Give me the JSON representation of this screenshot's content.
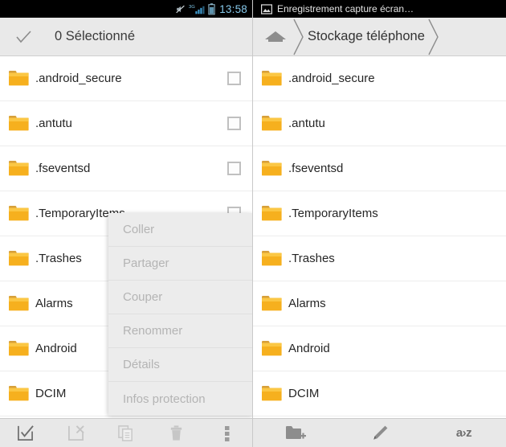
{
  "left": {
    "statusbar": {
      "time": "13:58",
      "icons": [
        "mute-crossed-icon",
        "signal-3g-icon",
        "battery-icon"
      ],
      "network_label": "3G"
    },
    "actionbar": {
      "check_icon": "checkmark-icon",
      "title": "0 Sélectionné"
    },
    "rows": [
      {
        "name": ".android_secure",
        "icon": "folder-icon",
        "checked": false
      },
      {
        "name": ".antutu",
        "icon": "folder-icon",
        "checked": false
      },
      {
        "name": ".fseventsd",
        "icon": "folder-icon",
        "checked": false
      },
      {
        "name": ".TemporaryItems",
        "icon": "folder-icon",
        "checked": false
      },
      {
        "name": ".Trashes",
        "icon": "folder-icon",
        "checked": false
      },
      {
        "name": "Alarms",
        "icon": "folder-icon",
        "checked": false
      },
      {
        "name": "Android",
        "icon": "folder-icon",
        "checked": false
      },
      {
        "name": "DCIM",
        "icon": "folder-icon",
        "checked": false
      }
    ],
    "context_menu": {
      "items": [
        {
          "label": "Coller",
          "disabled": true
        },
        {
          "label": "Partager",
          "disabled": true
        },
        {
          "label": "Couper",
          "disabled": true
        },
        {
          "label": "Renommer",
          "disabled": true
        },
        {
          "label": "Détails",
          "disabled": true
        },
        {
          "label": "Infos protection",
          "disabled": true
        }
      ]
    },
    "toolbar": {
      "buttons": [
        {
          "name": "select-all-icon",
          "label": "Tout sélectionner",
          "disabled": false
        },
        {
          "name": "deselect-all-icon",
          "label": "Tout désélectionner",
          "disabled": true
        },
        {
          "name": "copy-icon",
          "label": "Copier",
          "disabled": true
        },
        {
          "name": "delete-icon",
          "label": "Supprimer",
          "disabled": true
        },
        {
          "name": "overflow-menu-icon",
          "label": "Plus",
          "disabled": false
        }
      ]
    }
  },
  "right": {
    "statusbar": {
      "notification_icon": "screenshot-image-icon",
      "notification_text": "Enregistrement capture écran…"
    },
    "breadcrumb": {
      "home_icon": "home-icon",
      "segments": [
        "Stockage téléphone"
      ],
      "separator_icon": "chevron-right-icon"
    },
    "rows": [
      {
        "name": ".android_secure",
        "icon": "folder-icon"
      },
      {
        "name": ".antutu",
        "icon": "folder-icon"
      },
      {
        "name": ".fseventsd",
        "icon": "folder-icon"
      },
      {
        "name": ".TemporaryItems",
        "icon": "folder-icon"
      },
      {
        "name": ".Trashes",
        "icon": "folder-icon"
      },
      {
        "name": "Alarms",
        "icon": "folder-icon"
      },
      {
        "name": "Android",
        "icon": "folder-icon"
      },
      {
        "name": "DCIM",
        "icon": "folder-icon"
      }
    ],
    "toolbar": {
      "buttons": [
        {
          "name": "new-folder-icon",
          "label": "Nouveau dossier"
        },
        {
          "name": "edit-pencil-icon",
          "label": "Modifier"
        },
        {
          "name": "sort-az-icon",
          "label": "a›z"
        }
      ]
    }
  },
  "colors": {
    "folder": "#f6b01e",
    "folder_light": "#fbcd55",
    "statusbar_bg": "#000000",
    "bar_bg": "#e9e9e9",
    "accent_clock": "#86c8ea"
  }
}
